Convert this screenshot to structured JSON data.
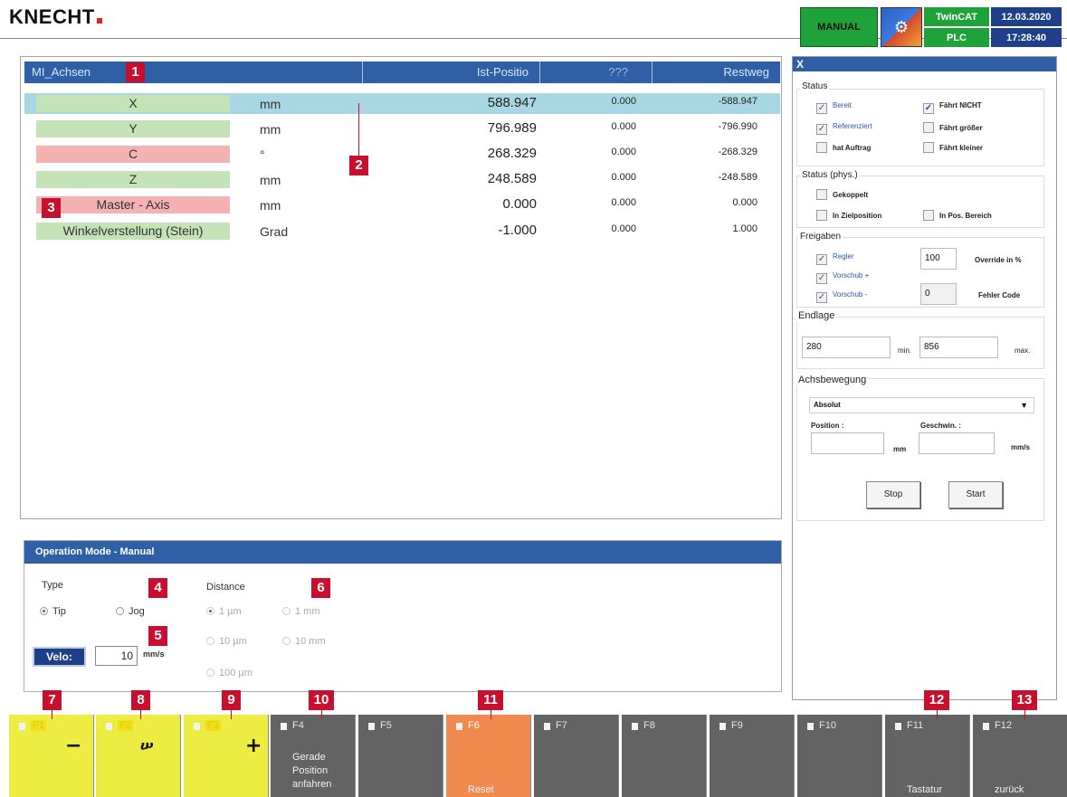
{
  "header": {
    "logo": "KNECHT",
    "mode": "MANUAL",
    "twincat": "TwinCAT",
    "plc": "PLC",
    "date": "12.03.2020",
    "time": "17:28:40"
  },
  "axes_table": {
    "columns": [
      "MI_Achsen",
      "Ist-Positio",
      "???",
      "Restweg"
    ],
    "rows": [
      {
        "name": "X",
        "unit": "mm",
        "pos": "588.947",
        "q": "0.000",
        "rest": "-588.947",
        "color": "green"
      },
      {
        "name": "Y",
        "unit": "mm",
        "pos": "796.989",
        "q": "0.000",
        "rest": "-796.990",
        "color": "green"
      },
      {
        "name": "C",
        "unit": "°",
        "pos": "268.329",
        "q": "0.000",
        "rest": "-268.329",
        "color": "red"
      },
      {
        "name": "Z",
        "unit": "mm",
        "pos": "248.589",
        "q": "0.000",
        "rest": "-248.589",
        "color": "green"
      },
      {
        "name": "Master - Axis",
        "unit": "mm",
        "pos": "0.000",
        "q": "0.000",
        "rest": "0.000",
        "color": "red"
      },
      {
        "name": "Winkelverstellung (Stein)",
        "unit": "Grad",
        "pos": "-1.000",
        "q": "0.000",
        "rest": "1.000",
        "color": "green"
      }
    ]
  },
  "operation_mode": {
    "title": "Operation Mode - Manual",
    "type_label": "Type",
    "type_tip": "Tip",
    "type_jog": "Jog",
    "distance_label": "Distance",
    "dist_1um": "1 µm",
    "dist_1mm": "1 mm",
    "dist_10um": "10 µm",
    "dist_10mm": "10 mm",
    "dist_100um": "100 µm",
    "velo_label": "Velo:",
    "velo_value": "10",
    "velo_unit": "mm/s"
  },
  "axis_panel": {
    "title": "X",
    "status_title": "Status",
    "bereit": "Bereit",
    "faehrt_nicht": "Fährt NICHT",
    "referenziert": "Referenziert",
    "faehrt_groesser": "Fährt größer",
    "hat_auftrag": "hat Auftrag",
    "faehrt_kleiner": "Fährt kleiner",
    "status_phys_title": "Status (phys.)",
    "gekoppelt": "Gekoppelt",
    "in_zielposition": "In Zielposition",
    "in_pos_bereich": "In Pos. Bereich",
    "freigaben_title": "Freigaben",
    "regler": "Regler",
    "override_value": "100",
    "override_label": "Override in %",
    "vorschub_plus": "Vorschub +",
    "vorschub_minus": "Vorschub -",
    "fehler_value": "0",
    "fehler_label": "Fehler Code",
    "endlage_title": "Endlage",
    "endlage_min_value": "280",
    "endlage_min_label": "min.",
    "endlage_max_value": "856",
    "endlage_max_label": "max.",
    "achsbewegung_title": "Achsbewegung",
    "mode_select": "Absolut",
    "position_label": "Position :",
    "position_unit": "mm",
    "geschwin_label": "Geschwin. :",
    "geschwin_unit": "mm/s",
    "stop": "Stop",
    "start": "Start"
  },
  "fkeys": [
    {
      "label": "F1",
      "caption": ""
    },
    {
      "label": "F2",
      "caption": ""
    },
    {
      "label": "F3",
      "caption": ""
    },
    {
      "label": "F4",
      "caption": "Gerade\nPosition\nanfahren"
    },
    {
      "label": "F5",
      "caption": ""
    },
    {
      "label": "F6",
      "caption": "Reset"
    },
    {
      "label": "F7",
      "caption": ""
    },
    {
      "label": "F8",
      "caption": ""
    },
    {
      "label": "F9",
      "caption": ""
    },
    {
      "label": "F10",
      "caption": ""
    },
    {
      "label": "F11",
      "caption": "Tastatur"
    },
    {
      "label": "F12",
      "caption": "zurück"
    }
  ],
  "fkey_captions": {
    "f4_l1": "Gerade",
    "f4_l2": "Position",
    "f4_l3": "anfahren",
    "f6": "Reset",
    "f11": "Tastatur",
    "f12": "zurück"
  },
  "callouts": [
    "1",
    "2",
    "3",
    "4",
    "5",
    "6",
    "7",
    "8",
    "9",
    "10",
    "11",
    "12",
    "13"
  ]
}
